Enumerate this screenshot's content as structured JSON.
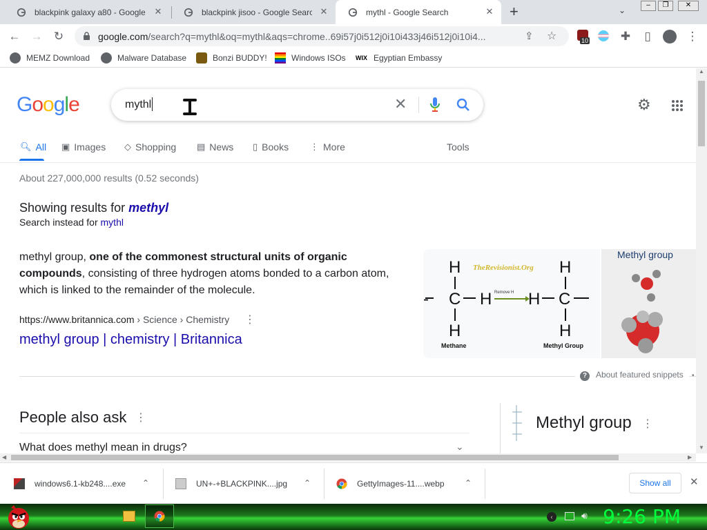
{
  "tabs": [
    {
      "title": "blackpink galaxy a80 - Google Se",
      "close": "✕"
    },
    {
      "title": "blackpink jisoo - Google Search",
      "close": "✕"
    },
    {
      "title": "mythl - Google Search",
      "close": "✕"
    }
  ],
  "new_tab": "+",
  "address": {
    "host": "google.com",
    "path": "/search?q=mythl&oq=mythl&aqs=chrome..69i57j0i512j0i10i433j46i512j0i10i4..."
  },
  "extension_badge": "10",
  "bookmarks": [
    {
      "label": "MEMZ Download"
    },
    {
      "label": "Malware Database"
    },
    {
      "label": "Bonzi BUDDY!"
    },
    {
      "label": "Windows ISOs"
    },
    {
      "label": "Egyptian Embassy"
    }
  ],
  "search": {
    "query": "mythl"
  },
  "nav_tabs": [
    "All",
    "Images",
    "Shopping",
    "News",
    "Books",
    "More"
  ],
  "tools": "Tools",
  "result_stats": "About 227,000,000 results (0.52 seconds)",
  "spelling": {
    "showing": "Showing results for",
    "corrected": "methyl",
    "instead": "Search instead for",
    "original": "mythl"
  },
  "snippet": {
    "lead": "methyl group, ",
    "bold": "one of the commonest structural units of organic compounds",
    "rest": ", consisting of three hydrogen atoms bonded to a carbon atom, which is linked to the remainder of the molecule.",
    "cite_domain": "https://www.britannica.com",
    "cite_path": " › Science › Chemistry",
    "title": "methyl group | chemistry | Britannica"
  },
  "image1": {
    "watermark": "TheRevisionist.Org",
    "arrow_label": "Remove H",
    "left_caption": "Methane",
    "right_caption": "Methyl Group"
  },
  "image2": {
    "caption": "Methyl group"
  },
  "about_snippets": "About featured snippets",
  "paa": {
    "title": "People also ask",
    "q1": "What does methyl mean in drugs?"
  },
  "kp_title": "Methyl group",
  "downloads": [
    {
      "name": "windows6.1-kb248....exe"
    },
    {
      "name": "UN+-+BLACKPINK....jpg"
    },
    {
      "name": "GettyImages-11....webp"
    }
  ],
  "show_all": "Show all",
  "clock": "9:26 PM",
  "colors": {
    "google_blue": "#4285f4",
    "google_red": "#ea4335",
    "google_yellow": "#fbbc05",
    "google_green": "#34a853",
    "link": "#1a0dab",
    "taskbar_green": "#00ff3c"
  }
}
